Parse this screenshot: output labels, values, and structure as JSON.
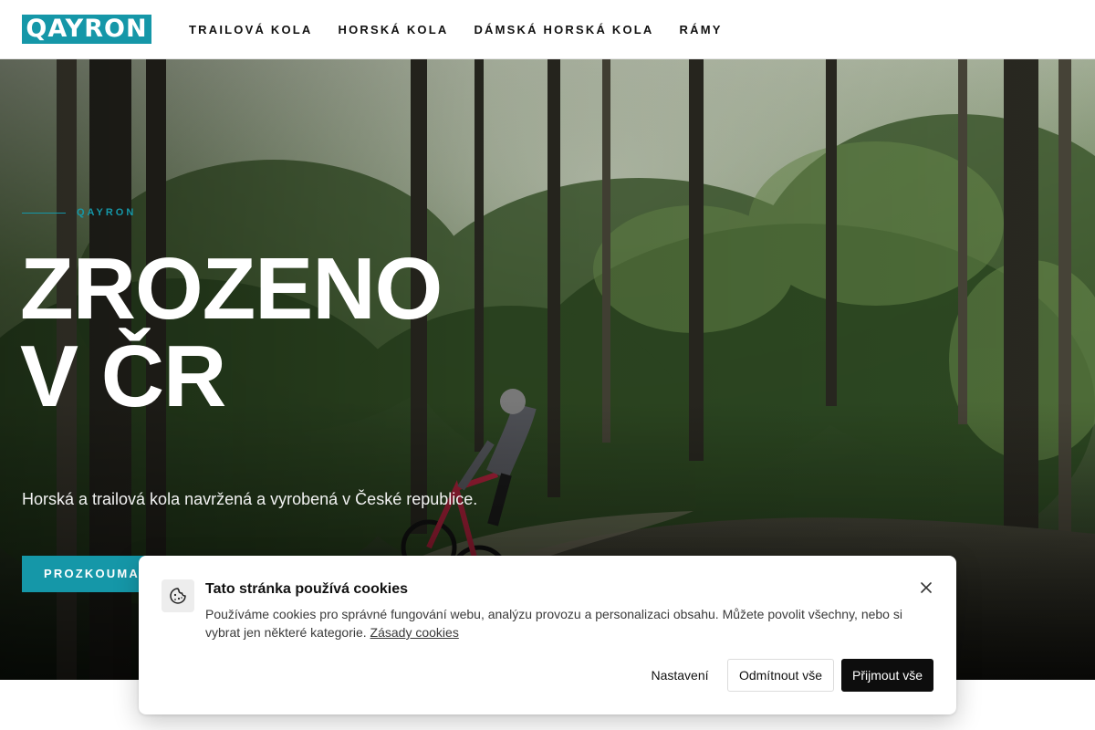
{
  "brand": {
    "logo_text": "QAYRON",
    "accent_color": "#1597a8"
  },
  "nav": {
    "items": [
      {
        "label": "TRAILOVÁ KOLA"
      },
      {
        "label": "HORSKÁ KOLA"
      },
      {
        "label": "DÁMSKÁ HORSKÁ KOLA"
      },
      {
        "label": "RÁMY"
      }
    ]
  },
  "hero": {
    "eyebrow": "QAYRON",
    "title_line1": "ZROZENO",
    "title_line2": "V ČR",
    "subtitle": "Horská a trailová kola navržená a vyrobená v České republice.",
    "cta_label": "PROZKOUMAT KOLA",
    "background": "forest-trail-mountain-biker-photo"
  },
  "cookie_banner": {
    "icon": "cookie-icon",
    "title": "Tato stránka používá cookies",
    "text": "Používáme cookies pro správné fungování webu, analýzu provozu a personalizaci obsahu. Můžete povolit všechny, nebo si vybrat jen některé kategorie.",
    "policy_link": "Zásady cookies",
    "close_icon": "close-icon",
    "buttons": {
      "settings": "Nastavení",
      "reject": "Odmítnout vše",
      "accept": "Přijmout vše"
    }
  }
}
